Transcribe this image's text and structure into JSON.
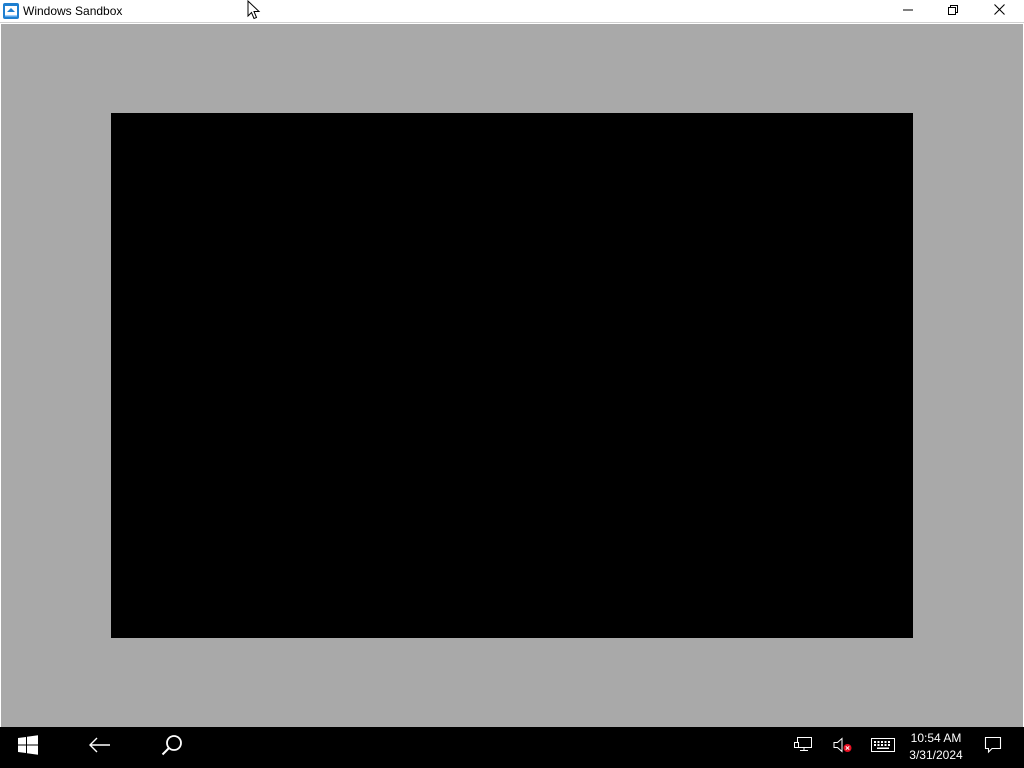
{
  "window": {
    "title": "Windows Sandbox",
    "controls": {
      "minimize": "minimize-icon",
      "restore": "restore-icon",
      "close": "close-icon"
    }
  },
  "colors": {
    "client_background": "#a9a9a9",
    "vm_screen": "#000000",
    "taskbar": "#000000",
    "titlebar": "#ffffff"
  },
  "taskbar": {
    "start": "windows-logo-icon",
    "back": "back-arrow-icon",
    "search": "search-icon",
    "tray": {
      "network": "network-icon",
      "volume": "volume-muted-icon",
      "keyboard": "touch-keyboard-icon",
      "notifications": "action-center-icon"
    },
    "clock": {
      "time": "10:54 AM",
      "date": "3/31/2024"
    }
  }
}
